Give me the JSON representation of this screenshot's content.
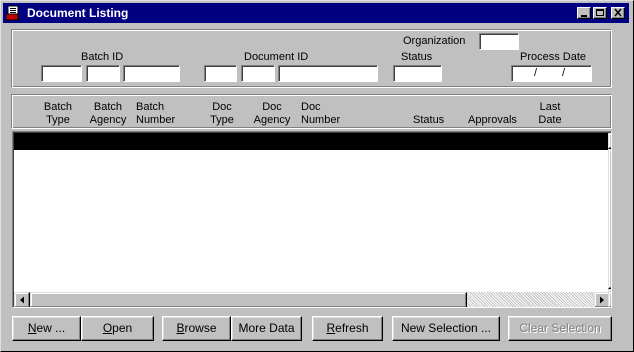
{
  "window": {
    "title": "Document Listing"
  },
  "filters": {
    "organization_label": "Organization",
    "batch_id_label": "Batch ID",
    "document_id_label": "Document ID",
    "status_label": "Status",
    "process_date_label": "Process Date",
    "process_date_sep1": "/",
    "process_date_sep2": "/"
  },
  "columns": [
    {
      "line1": "Batch",
      "line2": "Type"
    },
    {
      "line1": "Batch",
      "line2": "Agency"
    },
    {
      "line1": "Batch",
      "line2": "Number"
    },
    {
      "line1": "Doc",
      "line2": "Type"
    },
    {
      "line1": "Doc",
      "line2": "Agency"
    },
    {
      "line1": "Doc",
      "line2": "Number"
    },
    {
      "line1": "",
      "line2": "Status"
    },
    {
      "line1": "",
      "line2": "Approvals"
    },
    {
      "line1": "Last",
      "line2": "Date"
    }
  ],
  "buttons": {
    "new": {
      "mnemonic": "N",
      "rest": "ew ..."
    },
    "open": {
      "mnemonic": "O",
      "rest": "pen"
    },
    "browse": {
      "mnemonic": "B",
      "rest": "rowse"
    },
    "more_data": {
      "label": "More Data"
    },
    "refresh": {
      "mnemonic": "R",
      "rest": "efresh"
    },
    "new_selection": {
      "label": "New Selection ..."
    },
    "clear_selection": {
      "label": "Clear Selection"
    }
  },
  "colors": {
    "titlebar": "#000080",
    "face": "#c0c0c0",
    "selected_row": "#000000"
  }
}
